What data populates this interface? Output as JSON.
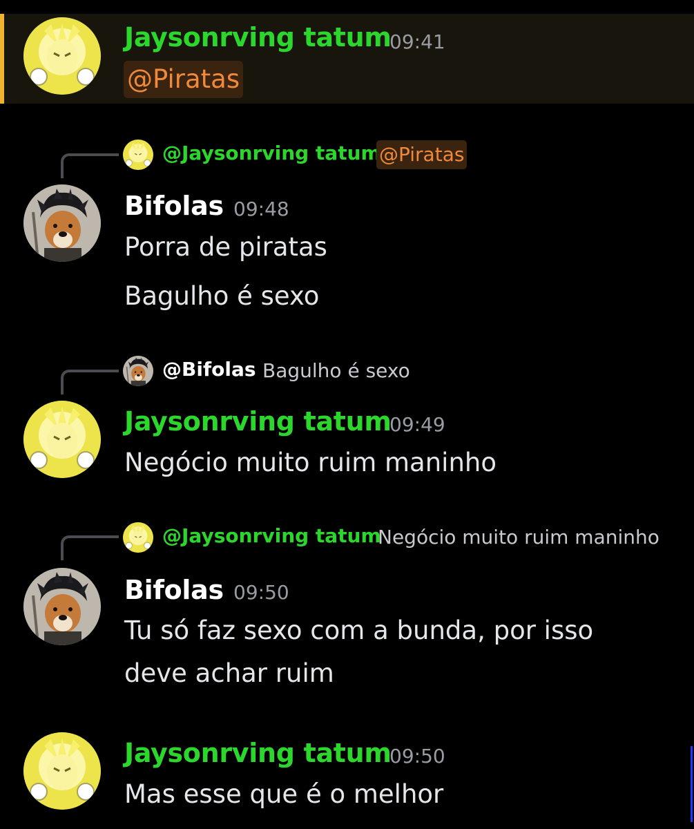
{
  "colors": {
    "background": "#000000",
    "highlight_bg": "#18150c",
    "highlight_bar": "#f0b232",
    "username_green": "#2cd62c",
    "username_white": "#ffffff",
    "mention_orange": "#f08a3a",
    "timestamp": "#9a9ca3"
  },
  "messages": [
    {
      "author": "Jaysonrving tatum",
      "avatar": "sun-avatar-icon",
      "time": "09:41",
      "mention": "@Piratas",
      "highlighted": true
    },
    {
      "reply": {
        "author": "@Jaysonrving tatum",
        "avatar": "sun-avatar-icon",
        "mention": "@Piratas"
      },
      "author": "Bifolas",
      "avatar": "dog-avatar-icon",
      "time": "09:48",
      "lines": [
        "Porra de piratas",
        "Bagulho é sexo"
      ]
    },
    {
      "reply": {
        "author": "@Bifolas",
        "avatar": "dog-avatar-icon",
        "text": "Bagulho é sexo"
      },
      "author": "Jaysonrving tatum",
      "avatar": "sun-avatar-icon",
      "time": "09:49",
      "lines": [
        "Negócio muito ruim maninho"
      ]
    },
    {
      "reply": {
        "author": "@Jaysonrving tatum",
        "avatar": "sun-avatar-icon",
        "text": "Negócio muito ruim maninho"
      },
      "author": "Bifolas",
      "avatar": "dog-avatar-icon",
      "time": "09:50",
      "lines": [
        "Tu só faz sexo com a bunda, por isso",
        "deve achar ruim"
      ]
    },
    {
      "author": "Jaysonrving tatum",
      "avatar": "sun-avatar-icon",
      "time": "09:50",
      "lines": [
        "Mas esse que é o melhor"
      ]
    }
  ]
}
